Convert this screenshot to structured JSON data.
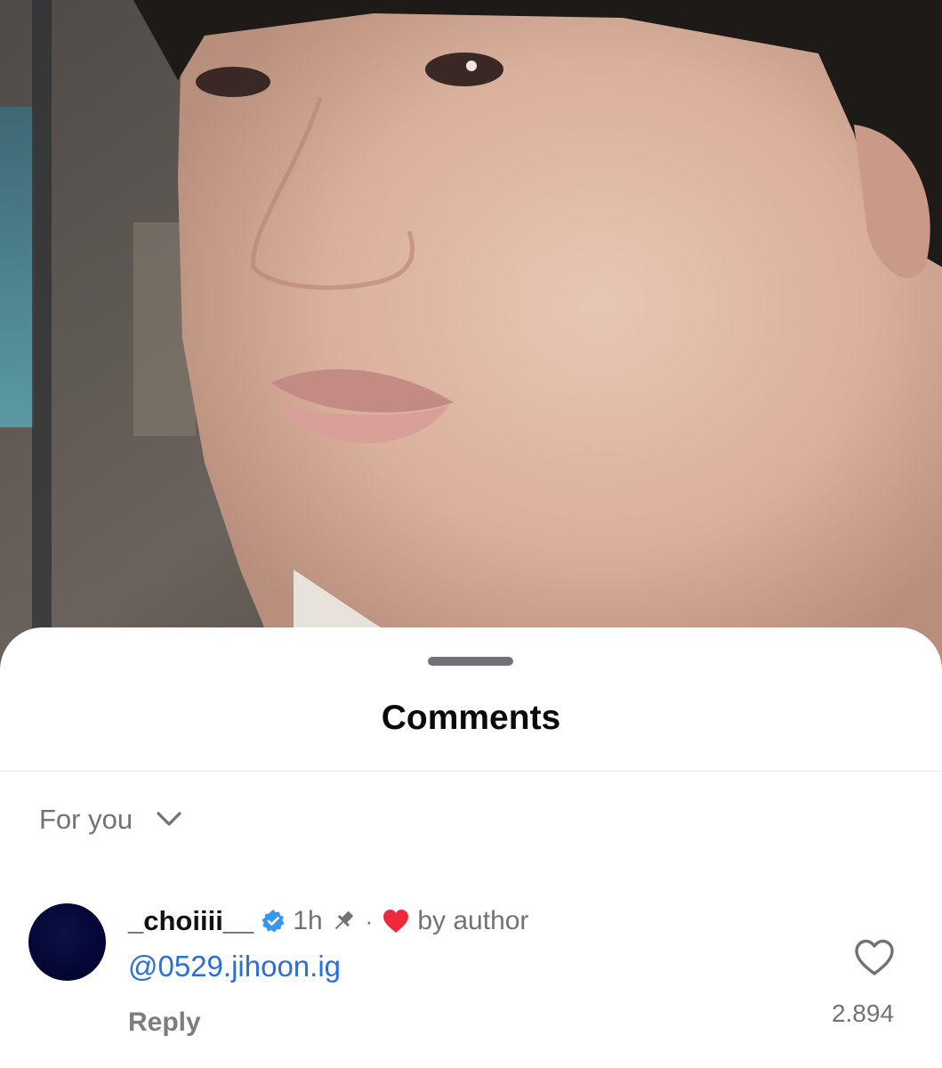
{
  "sheet": {
    "title": "Comments"
  },
  "sort": {
    "label": "For you",
    "icon": "chevron-down-icon"
  },
  "comment": {
    "username": "_choiiii__",
    "verified_icon": "verified-badge-icon",
    "time": "1h",
    "pinned_icon": "pin-icon",
    "separator": "·",
    "author_like_icon": "heart-filled-icon",
    "author_like_text": "by author",
    "text": "@0529.jihoon.ig",
    "reply_label": "Reply",
    "like_icon": "heart-outline-icon",
    "like_count": "2.894"
  },
  "colors": {
    "mention": "#2b6fd8",
    "verified": "#3897f0",
    "heart": "#ed2a3b",
    "muted": "#6f7378"
  }
}
